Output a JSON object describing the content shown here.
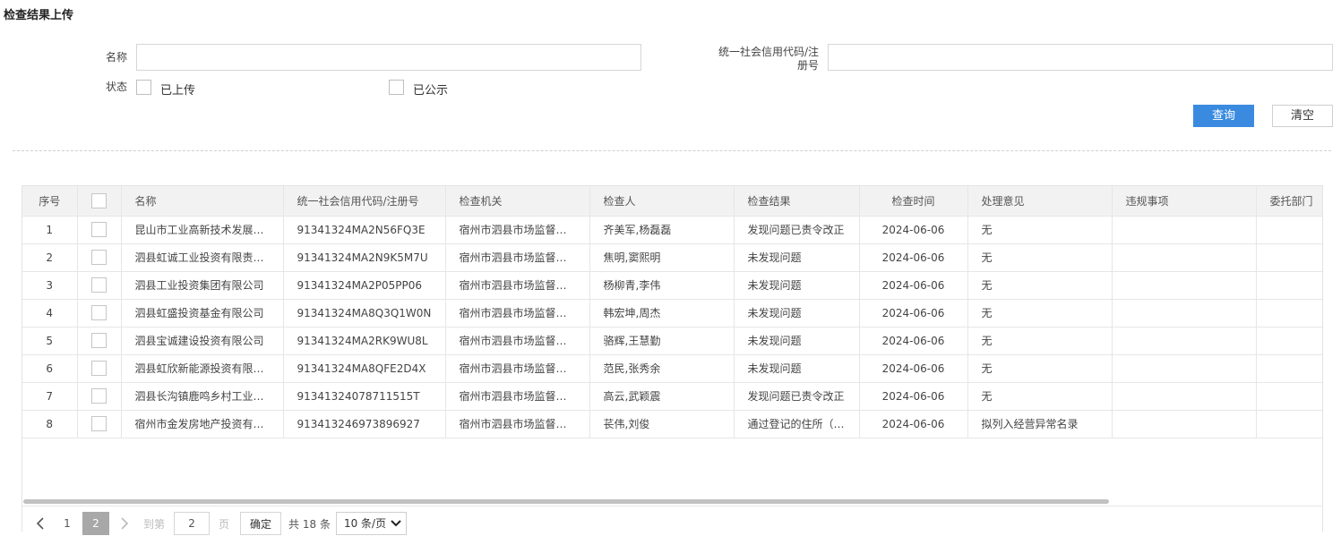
{
  "page": {
    "title": "检查结果上传"
  },
  "search": {
    "name_label": "名称",
    "name_value": "",
    "credit_label_line1": "统一社会信用代码/注",
    "credit_label_line2": "册号",
    "credit_value": "",
    "status_label": "状态",
    "status_options": [
      {
        "label": "已上传",
        "checked": false
      },
      {
        "label": "已公示",
        "checked": false
      }
    ],
    "query_button": "查询",
    "clear_button": "清空"
  },
  "table": {
    "columns": [
      "序号",
      "",
      "名称",
      "统一社会信用代码/注册号",
      "检查机关",
      "检查人",
      "检查结果",
      "检查时间",
      "处理意见",
      "违规事项",
      "委托部门"
    ],
    "rows": [
      [
        "1",
        "",
        "昆山市工业高新技术发展投资有限公司",
        "91341324MA2N56FQ3E",
        "宿州市泗县市场监督管理局",
        "齐美军,杨磊磊",
        "发现问题已责令改正",
        "2024-06-06",
        "无",
        "",
        ""
      ],
      [
        "2",
        "",
        "泗县虹诚工业投资有限责任公司",
        "91341324MA2N9K5M7U",
        "宿州市泗县市场监督管理局",
        "焦明,窦熙明",
        "未发现问题",
        "2024-06-06",
        "无",
        "",
        ""
      ],
      [
        "3",
        "",
        "泗县工业投资集团有限公司",
        "91341324MA2P05PP06",
        "宿州市泗县市场监督管理局",
        "杨柳青,李伟",
        "未发现问题",
        "2024-06-06",
        "无",
        "",
        ""
      ],
      [
        "4",
        "",
        "泗县虹盛投资基金有限公司",
        "91341324MA8Q3Q1W0N",
        "宿州市泗县市场监督管理局",
        "韩宏坤,周杰",
        "未发现问题",
        "2024-06-06",
        "无",
        "",
        ""
      ],
      [
        "5",
        "",
        "泗县宝诚建设投资有限公司",
        "91341324MA2RK9WU8L",
        "宿州市泗县市场监督管理局",
        "骆辉,王慧勤",
        "未发现问题",
        "2024-06-06",
        "无",
        "",
        ""
      ],
      [
        "6",
        "",
        "泗县虹欣新能源投资有限公司",
        "91341324MA8QFE2D4X",
        "宿州市泗县市场监督管理局",
        "范民,张秀余",
        "未发现问题",
        "2024-06-06",
        "无",
        "",
        ""
      ],
      [
        "7",
        "",
        "泗县长沟镇鹿鸣乡村工业园区",
        "91341324078711515T",
        "宿州市泗县市场监督管理局",
        "高云,武颖震",
        "发现问题已责令改正",
        "2024-06-06",
        "无",
        "",
        ""
      ],
      [
        "8",
        "",
        "宿州市金发房地产投资有限公司",
        "913413246973896927",
        "宿州市泗县市场监督管理局",
        "苌伟,刘俊",
        "通过登记的住所（经营场所）无法联系",
        "2024-06-06",
        "拟列入经营异常名录",
        "",
        ""
      ]
    ]
  },
  "pagination": {
    "pages": [
      "1",
      "2"
    ],
    "current": "2",
    "goto_prefix": "到第",
    "goto_value": "2",
    "goto_suffix": "页",
    "confirm": "确定",
    "total": "共 18 条",
    "page_size": "10 条/页"
  },
  "icons": {
    "prev": "chevron-left-icon",
    "next": "chevron-right-icon",
    "dropdown": "chevron-down-icon"
  },
  "colors": {
    "primary": "#3a8be0",
    "active_page": "#a8a8a8",
    "header_bg": "#f2f2f2"
  }
}
